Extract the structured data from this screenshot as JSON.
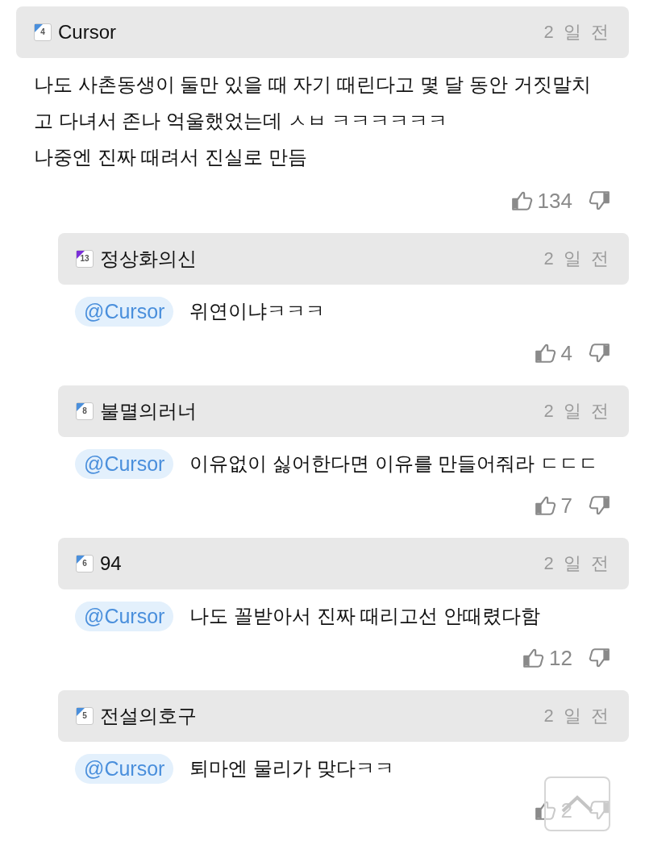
{
  "comment": {
    "author": "Cursor",
    "level": {
      "label": "4",
      "color": "#4a8fdc"
    },
    "time": "2 일 전",
    "text_lines": [
      "나도 사촌동생이 둘만 있을 때 자기 때린다고 몇 달 동안 거짓말치",
      "고 다녀서 존나 억울했었는데 ㅅㅂ ㅋㅋㅋㅋㅋㅋ",
      "나중엔 진짜 때려서 진실로 만듬"
    ],
    "likes": "134",
    "replies": [
      {
        "author": "정상화의신",
        "level": {
          "label": "13",
          "color": "#7a2fd8"
        },
        "time": "2 일 전",
        "mention": "@Cursor",
        "text": "위연이냐ㅋㅋㅋ",
        "likes": "4"
      },
      {
        "author": "불멸의러너",
        "level": {
          "label": "8",
          "color": "#4a8fdc"
        },
        "time": "2 일 전",
        "mention": "@Cursor",
        "text": "이유없이 싫어한다면 이유를 만들어줘라 ㄷㄷㄷ",
        "likes": "7"
      },
      {
        "author": "94",
        "level": {
          "label": "6",
          "color": "#4a8fdc"
        },
        "time": "2 일 전",
        "mention": "@Cursor",
        "text": "나도 꼴받아서 진짜 때리고선 안때렸다함",
        "likes": "12"
      },
      {
        "author": "전설의호구",
        "level": {
          "label": "5",
          "color": "#4a8fdc"
        },
        "time": "2 일 전",
        "mention": "@Cursor",
        "text": "퇴마엔 물리가 맞다ㅋㅋ",
        "likes": "2"
      }
    ]
  }
}
